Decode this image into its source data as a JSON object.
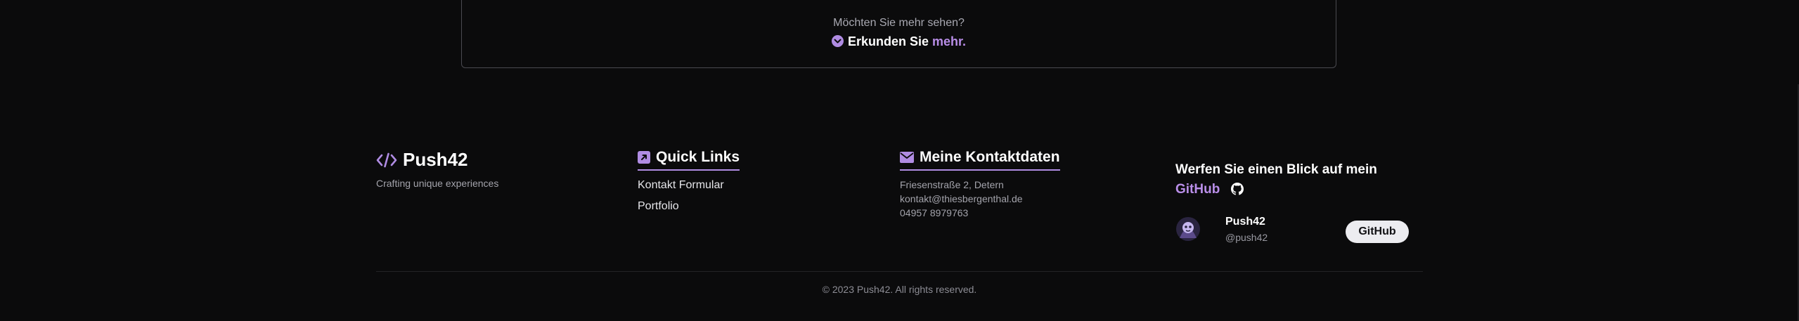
{
  "more_section": {
    "question": "Möchten Sie mehr sehen?",
    "action_prefix": "Erkunden Sie",
    "action_highlight": "mehr."
  },
  "brand": {
    "name": "Push42",
    "tagline": "Crafting unique experiences",
    "logo_icon": "code-brackets-icon"
  },
  "quick_links": {
    "title": "Quick Links",
    "icon": "arrow-square-icon",
    "items": [
      {
        "label": "Kontakt Formular"
      },
      {
        "label": "Portfolio"
      }
    ]
  },
  "contact": {
    "title": "Meine Kontaktdaten",
    "icon": "envelope-icon",
    "address": "Friesenstraße 2, Detern",
    "email": "kontakt@thiesbergenthal.de",
    "phone": "04957 8979763"
  },
  "github": {
    "heading": "Werfen Sie einen Blick auf mein",
    "heading_highlight": "GitHub",
    "profile_name": "Push42",
    "profile_handle": "@push42",
    "button_label": "GitHub"
  },
  "footer": {
    "copyright": "© 2023 Push42. All rights reserved."
  },
  "colors": {
    "background": "#0b0b0c",
    "accent": "#b08ce3",
    "text_primary": "#ffffff",
    "text_muted": "#a3a3ab"
  }
}
